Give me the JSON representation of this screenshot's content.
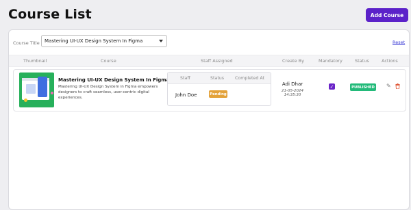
{
  "header": {
    "title": "Course List",
    "add_label": "Add Course"
  },
  "filter": {
    "label": "Course Title",
    "selected": "Mastering UI-UX Design System In Figma",
    "reset_label": "Reset"
  },
  "table": {
    "columns": [
      "Thumbnail",
      "Course",
      "Staff Assigned",
      "Create By",
      "Mandatory",
      "Status",
      "Actions"
    ],
    "staff_columns": [
      "Staff",
      "Status",
      "Completed At"
    ],
    "rows": [
      {
        "course_title": "Mastering UI-UX Design System In Figma",
        "course_desc": "Mastering UI-UX Design System in Figma empowers designers to craft seamless, user-centric digital experiences.",
        "staff": [
          {
            "name": "John Doe",
            "status": "Pending",
            "completed_at": ""
          }
        ],
        "created_by": "Adi Dhar",
        "created_at": "21-05-2024 14:35:30",
        "mandatory": true,
        "status": "PUBLISHED",
        "actions": {
          "edit_icon": "pencil-icon",
          "delete_icon": "trash-icon"
        }
      }
    ]
  },
  "colors": {
    "primary": "#5b21c9",
    "pending": "#e3a23a",
    "published": "#23ba7a",
    "delete": "#e05a3a"
  }
}
